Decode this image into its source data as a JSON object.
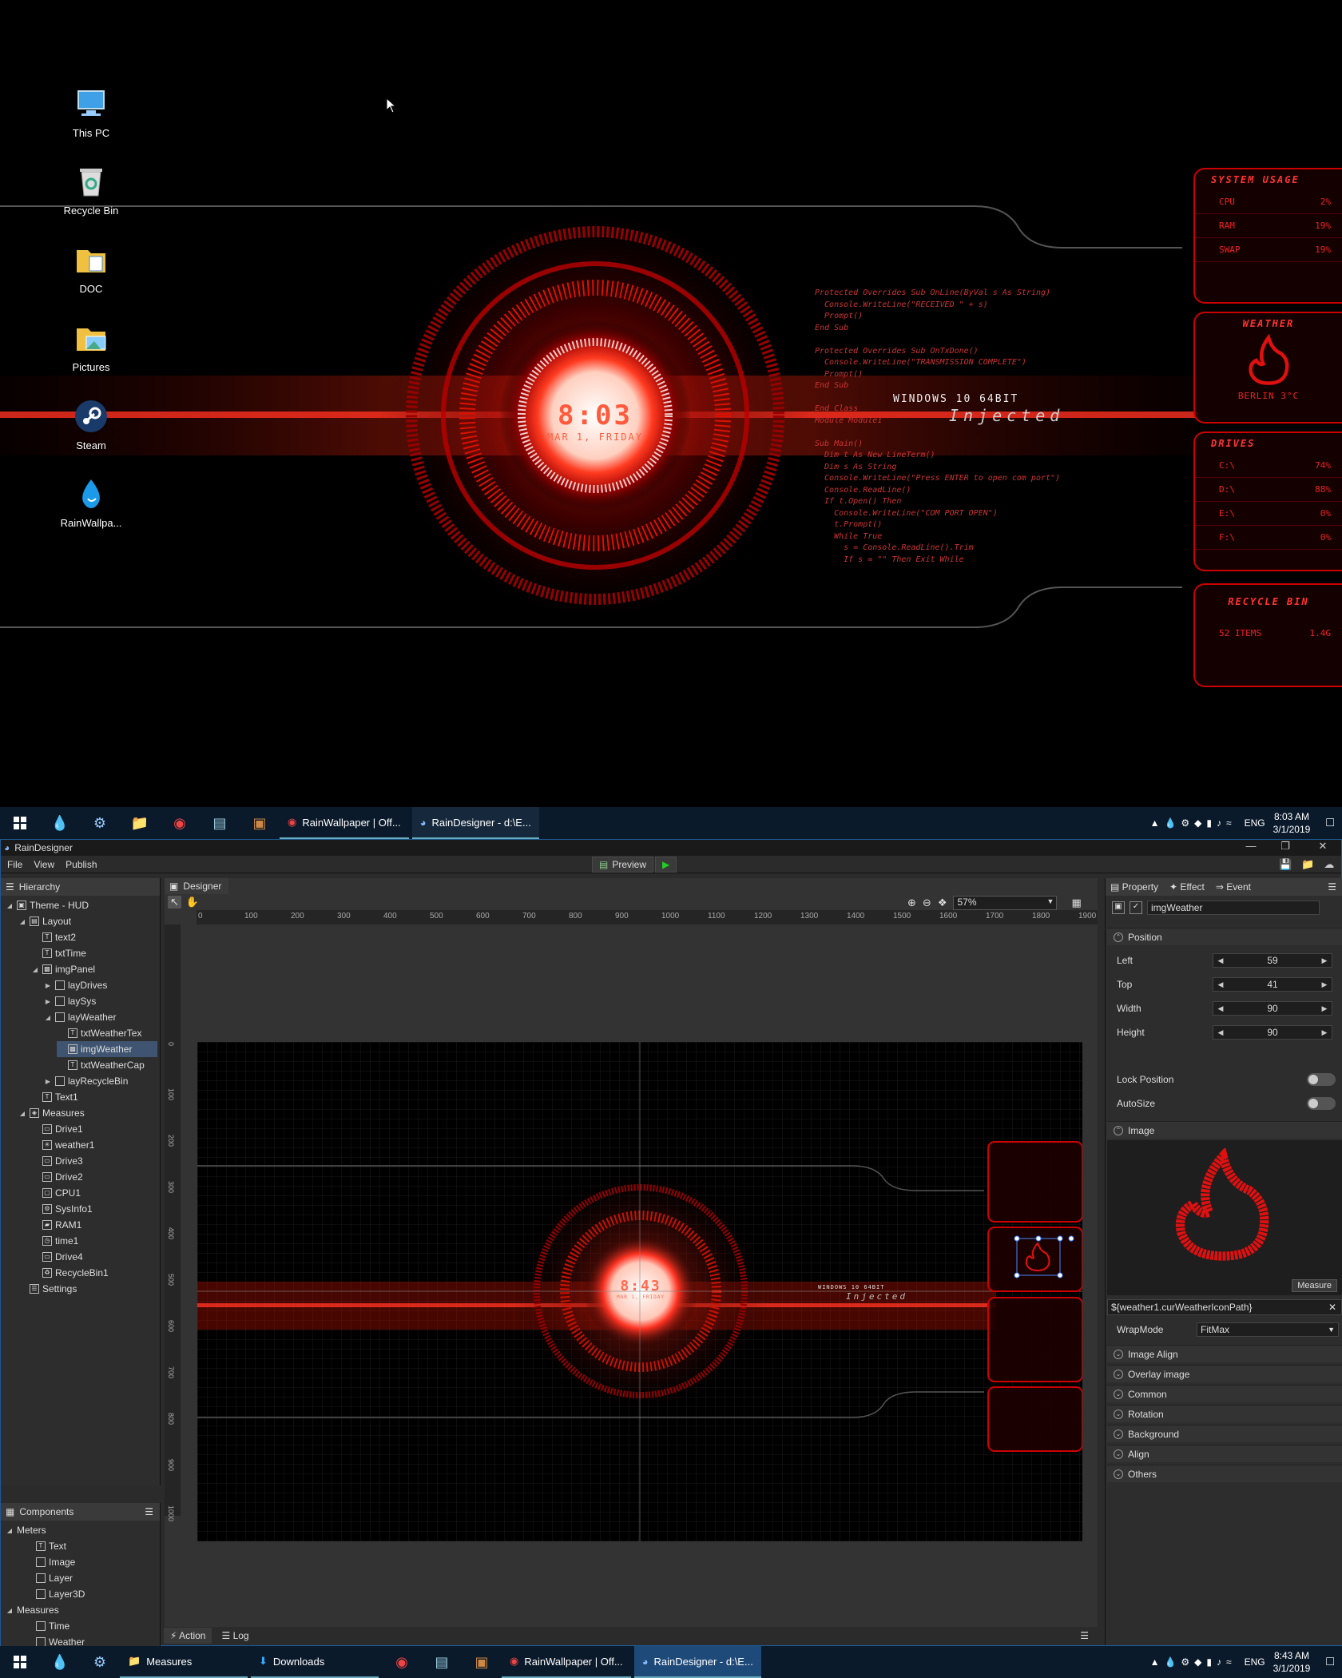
{
  "desktop": {
    "icons": [
      {
        "label": "This PC",
        "icon": "pc-icon"
      },
      {
        "label": "Recycle Bin",
        "icon": "recycle-bin-icon"
      },
      {
        "label": "DOC",
        "icon": "folder-icon"
      },
      {
        "label": "Pictures",
        "icon": "folder-icon"
      },
      {
        "label": "Steam",
        "icon": "steam-icon"
      },
      {
        "label": "RainWallpa...",
        "icon": "raindrop-icon"
      }
    ],
    "clock": {
      "time": "8:03",
      "date": "MAR 1, FRIDAY"
    },
    "os_text": "WINDOWS 10 64BIT",
    "injected": "Injected",
    "code_lines": [
      "Protected Overrides Sub OnLine(ByVal s As String)",
      "  Console.WriteLine(\"RECEIVED \" + s)",
      "  Prompt()",
      "End Sub",
      "",
      "Protected Overrides Sub OnTxDone()",
      "  Console.WriteLine(\"TRANSMISSION COMPLETE\")",
      "  Prompt()",
      "End Sub",
      "",
      "End Class",
      "Module Module1",
      "",
      "Sub Main()",
      "  Dim t As New LineTerm()",
      "  Dim s As String",
      "  Console.WriteLine(\"Press ENTER to open com port\")",
      "  Console.ReadLine()",
      "  If t.Open() Then",
      "    Console.WriteLine(\"COM PORT OPEN\")",
      "    t.Prompt()",
      "    While True",
      "      s = Console.ReadLine().Trim",
      "      If s = \"\" Then Exit While"
    ],
    "panels": {
      "system": {
        "title": "SYSTEM USAGE",
        "rows": [
          [
            "CPU",
            "2%"
          ],
          [
            "RAM",
            "19%"
          ],
          [
            "SWAP",
            "19%"
          ]
        ]
      },
      "weather": {
        "title": "WEATHER",
        "caption": "BERLIN 3°C"
      },
      "drives": {
        "title": "DRIVES",
        "rows": [
          [
            "C:\\",
            "74%"
          ],
          [
            "D:\\",
            "88%"
          ],
          [
            "E:\\",
            "0%"
          ],
          [
            "F:\\",
            "0%"
          ]
        ]
      },
      "recycle": {
        "title": "RECYCLE BIN",
        "items": "52 ITEMS",
        "size": "1.4G"
      }
    }
  },
  "taskbar_top": {
    "apps": [
      "RainWallpaper | Off...",
      "RainDesigner - d:\\E..."
    ],
    "lang": "ENG",
    "time": "8:03 AM",
    "date": "3/1/2019"
  },
  "taskbar_bottom": {
    "apps": [
      "Measures",
      "Downloads",
      "RainWallpaper | Off...",
      "RainDesigner - d:\\E..."
    ],
    "lang": "ENG",
    "time": "8:43 AM",
    "date": "3/1/2019"
  },
  "app": {
    "title": "RainDesigner",
    "menu": [
      "File",
      "View",
      "Publish"
    ],
    "preview": "Preview",
    "hierarchy_tab": "Hierarchy",
    "designer_tab": "Designer",
    "zoom": "57%",
    "ruler_h": [
      "0",
      "100",
      "200",
      "300",
      "400",
      "500",
      "600",
      "700",
      "800",
      "900",
      "1000",
      "1100",
      "1200",
      "1300",
      "1400",
      "1500",
      "1600",
      "1700",
      "1800",
      "1900"
    ],
    "ruler_v": [
      "0",
      "100",
      "200",
      "300",
      "400",
      "500",
      "600",
      "700",
      "800",
      "900",
      "1000"
    ],
    "tree": [
      {
        "label": "Theme - HUD",
        "depth": 0,
        "arrow": "down",
        "icon": "theme-icon"
      },
      {
        "label": "Layout",
        "depth": 1,
        "arrow": "down",
        "icon": "layout-icon"
      },
      {
        "label": "text2",
        "depth": 2,
        "arrow": "",
        "icon": "text-icon"
      },
      {
        "label": "txtTime",
        "depth": 2,
        "arrow": "",
        "icon": "text-icon"
      },
      {
        "label": "imgPanel",
        "depth": 2,
        "arrow": "down",
        "icon": "image-icon"
      },
      {
        "label": "layDrives",
        "depth": 3,
        "arrow": "right",
        "icon": "layer-icon"
      },
      {
        "label": "laySys",
        "depth": 3,
        "arrow": "right",
        "icon": "layer-icon"
      },
      {
        "label": "layWeather",
        "depth": 3,
        "arrow": "down",
        "icon": "layer-icon"
      },
      {
        "label": "txtWeatherTex",
        "depth": 4,
        "arrow": "",
        "icon": "text-icon"
      },
      {
        "label": "imgWeather",
        "depth": 4,
        "arrow": "",
        "icon": "image-icon",
        "selected": true
      },
      {
        "label": "txtWeatherCap",
        "depth": 4,
        "arrow": "",
        "icon": "text-icon"
      },
      {
        "label": "layRecycleBin",
        "depth": 3,
        "arrow": "right",
        "icon": "layer-icon"
      },
      {
        "label": "Text1",
        "depth": 2,
        "arrow": "",
        "icon": "text-icon"
      },
      {
        "label": "Measures",
        "depth": 1,
        "arrow": "down",
        "icon": "measures-icon"
      },
      {
        "label": "Drive1",
        "depth": 2,
        "arrow": "",
        "icon": "drive-icon"
      },
      {
        "label": "weather1",
        "depth": 2,
        "arrow": "",
        "icon": "weather-icon"
      },
      {
        "label": "Drive3",
        "depth": 2,
        "arrow": "",
        "icon": "drive-icon"
      },
      {
        "label": "Drive2",
        "depth": 2,
        "arrow": "",
        "icon": "drive-icon"
      },
      {
        "label": "CPU1",
        "depth": 2,
        "arrow": "",
        "icon": "cpu-icon"
      },
      {
        "label": "SysInfo1",
        "depth": 2,
        "arrow": "",
        "icon": "sysinfo-icon"
      },
      {
        "label": "RAM1",
        "depth": 2,
        "arrow": "",
        "icon": "ram-icon"
      },
      {
        "label": "time1",
        "depth": 2,
        "arrow": "",
        "icon": "clock-icon"
      },
      {
        "label": "Drive4",
        "depth": 2,
        "arrow": "",
        "icon": "drive-icon"
      },
      {
        "label": "RecycleBin1",
        "depth": 2,
        "arrow": "",
        "icon": "recycle-bin-icon"
      },
      {
        "label": "Settings",
        "depth": 1,
        "arrow": "",
        "icon": "settings-icon"
      }
    ],
    "components": {
      "tab": "Components",
      "groups": [
        {
          "label": "Meters",
          "items": [
            "Text",
            "Image",
            "Layer",
            "Layer3D"
          ]
        },
        {
          "label": "Measures",
          "items": [
            "Time",
            "Weather"
          ]
        }
      ]
    },
    "mini": {
      "time": "8:43",
      "date": "MAR 1, FRIDAY",
      "os_text": "WINDOWS 10 64BIT",
      "injected": "Injected"
    },
    "props": {
      "tabs": [
        "Property",
        "Effect",
        "Event"
      ],
      "name": "imgWeather",
      "position_section": "Position",
      "fields": [
        {
          "label": "Left",
          "value": "59"
        },
        {
          "label": "Top",
          "value": "41"
        },
        {
          "label": "Width",
          "value": "90"
        },
        {
          "label": "Height",
          "value": "90"
        }
      ],
      "lock_position": "Lock Position",
      "autosize": "AutoSize",
      "image_section": "Image",
      "measure_btn": "Measure",
      "path": "${weather1.curWeatherIconPath}",
      "wrapmode_label": "WrapMode",
      "wrapmode_value": "FitMax",
      "sections": [
        "Image Align",
        "Overlay image",
        "Common",
        "Rotation",
        "Background",
        "Align",
        "Others"
      ]
    },
    "measure_list": [
      {
        "label": "Drive1",
        "icon": "drive-icon"
      },
      {
        "label": "weather1",
        "icon": "weather-icon"
      },
      {
        "label": "Drive3",
        "icon": "drive-icon"
      },
      {
        "label": "Drive2",
        "icon": "drive-icon"
      },
      {
        "label": "CPU1",
        "icon": "cpu-icon"
      },
      {
        "label": "SysInfo1",
        "icon": "sysinfo-icon"
      },
      {
        "label": "RAM1",
        "icon": "ram-icon"
      },
      {
        "label": "time1",
        "icon": "clock-icon"
      },
      {
        "label": "Drive4",
        "icon": "drive-icon"
      },
      {
        "label": "RecycleBin1",
        "icon": "recycle-bin-icon"
      }
    ],
    "bottom_tabs": [
      "Action",
      "Log"
    ]
  },
  "colors": {
    "hud_red": "#e01010",
    "accent_blue": "#1e5a95",
    "selection": "#3f5470"
  }
}
